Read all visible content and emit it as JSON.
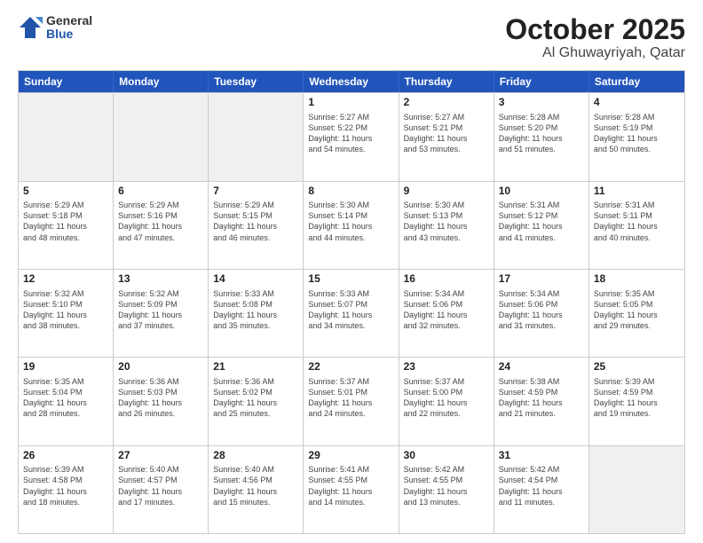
{
  "header": {
    "logo_general": "General",
    "logo_blue": "Blue",
    "title": "October 2025",
    "location": "Al Ghuwayriyah, Qatar"
  },
  "days_of_week": [
    "Sunday",
    "Monday",
    "Tuesday",
    "Wednesday",
    "Thursday",
    "Friday",
    "Saturday"
  ],
  "weeks": [
    [
      {
        "day": "",
        "info": ""
      },
      {
        "day": "",
        "info": ""
      },
      {
        "day": "",
        "info": ""
      },
      {
        "day": "1",
        "info": "Sunrise: 5:27 AM\nSunset: 5:22 PM\nDaylight: 11 hours\nand 54 minutes."
      },
      {
        "day": "2",
        "info": "Sunrise: 5:27 AM\nSunset: 5:21 PM\nDaylight: 11 hours\nand 53 minutes."
      },
      {
        "day": "3",
        "info": "Sunrise: 5:28 AM\nSunset: 5:20 PM\nDaylight: 11 hours\nand 51 minutes."
      },
      {
        "day": "4",
        "info": "Sunrise: 5:28 AM\nSunset: 5:19 PM\nDaylight: 11 hours\nand 50 minutes."
      }
    ],
    [
      {
        "day": "5",
        "info": "Sunrise: 5:29 AM\nSunset: 5:18 PM\nDaylight: 11 hours\nand 48 minutes."
      },
      {
        "day": "6",
        "info": "Sunrise: 5:29 AM\nSunset: 5:16 PM\nDaylight: 11 hours\nand 47 minutes."
      },
      {
        "day": "7",
        "info": "Sunrise: 5:29 AM\nSunset: 5:15 PM\nDaylight: 11 hours\nand 46 minutes."
      },
      {
        "day": "8",
        "info": "Sunrise: 5:30 AM\nSunset: 5:14 PM\nDaylight: 11 hours\nand 44 minutes."
      },
      {
        "day": "9",
        "info": "Sunrise: 5:30 AM\nSunset: 5:13 PM\nDaylight: 11 hours\nand 43 minutes."
      },
      {
        "day": "10",
        "info": "Sunrise: 5:31 AM\nSunset: 5:12 PM\nDaylight: 11 hours\nand 41 minutes."
      },
      {
        "day": "11",
        "info": "Sunrise: 5:31 AM\nSunset: 5:11 PM\nDaylight: 11 hours\nand 40 minutes."
      }
    ],
    [
      {
        "day": "12",
        "info": "Sunrise: 5:32 AM\nSunset: 5:10 PM\nDaylight: 11 hours\nand 38 minutes."
      },
      {
        "day": "13",
        "info": "Sunrise: 5:32 AM\nSunset: 5:09 PM\nDaylight: 11 hours\nand 37 minutes."
      },
      {
        "day": "14",
        "info": "Sunrise: 5:33 AM\nSunset: 5:08 PM\nDaylight: 11 hours\nand 35 minutes."
      },
      {
        "day": "15",
        "info": "Sunrise: 5:33 AM\nSunset: 5:07 PM\nDaylight: 11 hours\nand 34 minutes."
      },
      {
        "day": "16",
        "info": "Sunrise: 5:34 AM\nSunset: 5:06 PM\nDaylight: 11 hours\nand 32 minutes."
      },
      {
        "day": "17",
        "info": "Sunrise: 5:34 AM\nSunset: 5:06 PM\nDaylight: 11 hours\nand 31 minutes."
      },
      {
        "day": "18",
        "info": "Sunrise: 5:35 AM\nSunset: 5:05 PM\nDaylight: 11 hours\nand 29 minutes."
      }
    ],
    [
      {
        "day": "19",
        "info": "Sunrise: 5:35 AM\nSunset: 5:04 PM\nDaylight: 11 hours\nand 28 minutes."
      },
      {
        "day": "20",
        "info": "Sunrise: 5:36 AM\nSunset: 5:03 PM\nDaylight: 11 hours\nand 26 minutes."
      },
      {
        "day": "21",
        "info": "Sunrise: 5:36 AM\nSunset: 5:02 PM\nDaylight: 11 hours\nand 25 minutes."
      },
      {
        "day": "22",
        "info": "Sunrise: 5:37 AM\nSunset: 5:01 PM\nDaylight: 11 hours\nand 24 minutes."
      },
      {
        "day": "23",
        "info": "Sunrise: 5:37 AM\nSunset: 5:00 PM\nDaylight: 11 hours\nand 22 minutes."
      },
      {
        "day": "24",
        "info": "Sunrise: 5:38 AM\nSunset: 4:59 PM\nDaylight: 11 hours\nand 21 minutes."
      },
      {
        "day": "25",
        "info": "Sunrise: 5:39 AM\nSunset: 4:59 PM\nDaylight: 11 hours\nand 19 minutes."
      }
    ],
    [
      {
        "day": "26",
        "info": "Sunrise: 5:39 AM\nSunset: 4:58 PM\nDaylight: 11 hours\nand 18 minutes."
      },
      {
        "day": "27",
        "info": "Sunrise: 5:40 AM\nSunset: 4:57 PM\nDaylight: 11 hours\nand 17 minutes."
      },
      {
        "day": "28",
        "info": "Sunrise: 5:40 AM\nSunset: 4:56 PM\nDaylight: 11 hours\nand 15 minutes."
      },
      {
        "day": "29",
        "info": "Sunrise: 5:41 AM\nSunset: 4:55 PM\nDaylight: 11 hours\nand 14 minutes."
      },
      {
        "day": "30",
        "info": "Sunrise: 5:42 AM\nSunset: 4:55 PM\nDaylight: 11 hours\nand 13 minutes."
      },
      {
        "day": "31",
        "info": "Sunrise: 5:42 AM\nSunset: 4:54 PM\nDaylight: 11 hours\nand 11 minutes."
      },
      {
        "day": "",
        "info": ""
      }
    ]
  ]
}
